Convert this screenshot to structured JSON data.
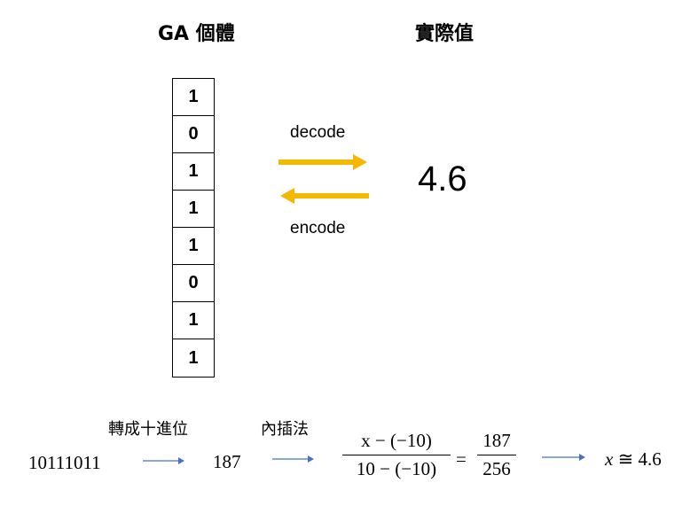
{
  "headings": {
    "ga_individual": "GA 個體",
    "real_value": "實際值"
  },
  "bits": [
    "1",
    "0",
    "1",
    "1",
    "1",
    "0",
    "1",
    "1"
  ],
  "arrows": {
    "decode_label": "decode",
    "encode_label": "encode",
    "color": "#f5b800"
  },
  "real_value": "4.6",
  "bottom": {
    "binary": "10111011",
    "to_decimal_label": "轉成十進位",
    "decimal": "187",
    "interpolation_label": "內插法",
    "lhs_numerator": "x − (−10)",
    "lhs_denominator": "10 − (−10)",
    "equals": "=",
    "rhs_numerator": "187",
    "rhs_denominator": "256",
    "result_var": "x",
    "approx": "≅",
    "result_value": "4.6",
    "arrow_color": "#4472c4"
  }
}
